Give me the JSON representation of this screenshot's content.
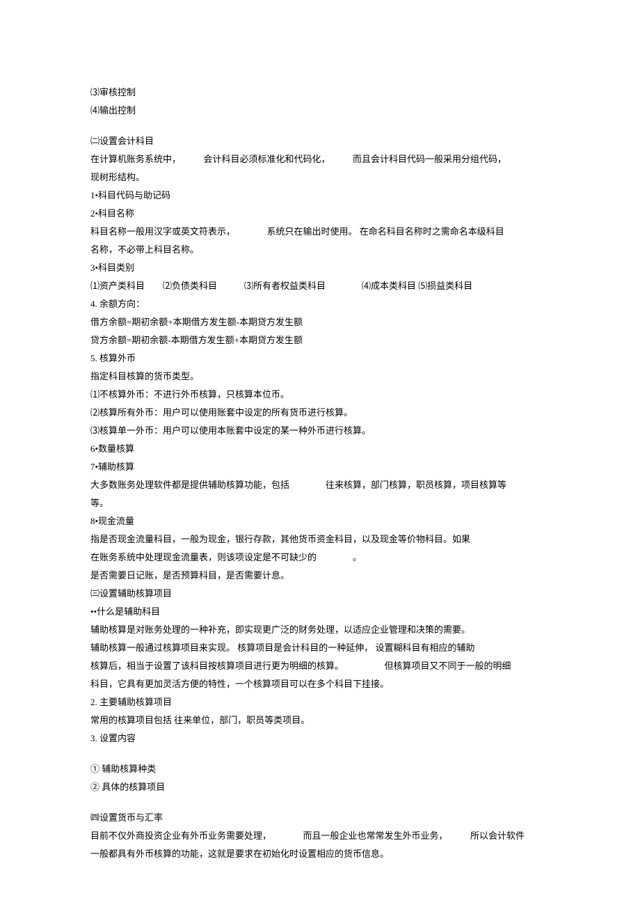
{
  "lines": [
    "⑶审核控制",
    "⑷输出控制",
    "",
    "㈡设置会计科目",
    "在计算机账务系统中，　　　会计科目必须标准化和代码化，　　　而且会计科目代码一般采用分组代码，",
    "现树形结构。",
    "1•科目代码与助记码",
    "2•科目名称",
    "科目名称一般用汉字或英文符表示，　　　　系统只在输出时使用。 在命名科目名称时之需命名本级科目",
    "名称，不必带上科目名称。",
    "3•科目类别",
    "⑴资产类科目　　⑵负债类科目　　　⑶所有者权益类科目　　　　⑷成本类科目 ⑸损益类科目",
    "4.  余额方向：",
    "借方余额=期初余额+本期借方发生额-本期贷方发生额",
    "贷方余额=期初余额-本期借方发生额+本期贷方发生额",
    "5.  核算外币",
    "指定科目核算的货币类型。",
    "⑴不核算外币：不进行外币核算，只核算本位币。",
    "⑵核算所有外币：用户可以使用账套中设定的所有货币进行核算。",
    "⑶核算单一外币：用户可以使用本账套中设定的某一种外币进行核算。",
    "6•数量核算",
    "7•辅助核算",
    "大多数账务处理软件都是提供辅助核算功能，包括　　　　往来核算，部门核算，职员核算，项目核算等",
    "等。",
    "8•现金流量",
    "指是否现金流量科目，一般为现金，银行存款，其他货币资金科目，以及现金等价物科目。如果",
    "在账务系统中处理现金流量表，则该项设定是不可缺少的　　　　。",
    "是否需要日记账，是否预算科目，是否需要计息。",
    "㈢设置辅助核算项目",
    "••什么是辅助科目",
    "辅助核算是对账务处理的一种补充，即实现更广泛的财务处理，以适应企业管理和决策的需要。",
    "辅助核算一般通过核算项目来实现。 核算项目是会计科目的一种延伸， 设置糊科目有相应的辅助",
    "核算后，相当于设置了该科目按核算项目进行更为明细的核算。　　　　　但核算项目又不同于一般的明细",
    "科目，它具有更加灵活方便的特性，一个核算项目可以在多个科目下挂接。",
    "2.  主要辅助核算项目",
    "常用的核算项目包括 往来单位，部门，职员等类项目。",
    "3.  设置内容",
    "",
    "①  辅助核算种类",
    "②  具体的核算项目",
    "",
    "㈣设置货币与汇率",
    "目前不仅外商投资企业有外币业务需要处理，　　　　而且一般企业也常常发生外币业务，　　　所以会计软件",
    "一般都具有外币核算的功能，这就是要求在初始化时设置相应的货币信息。"
  ]
}
